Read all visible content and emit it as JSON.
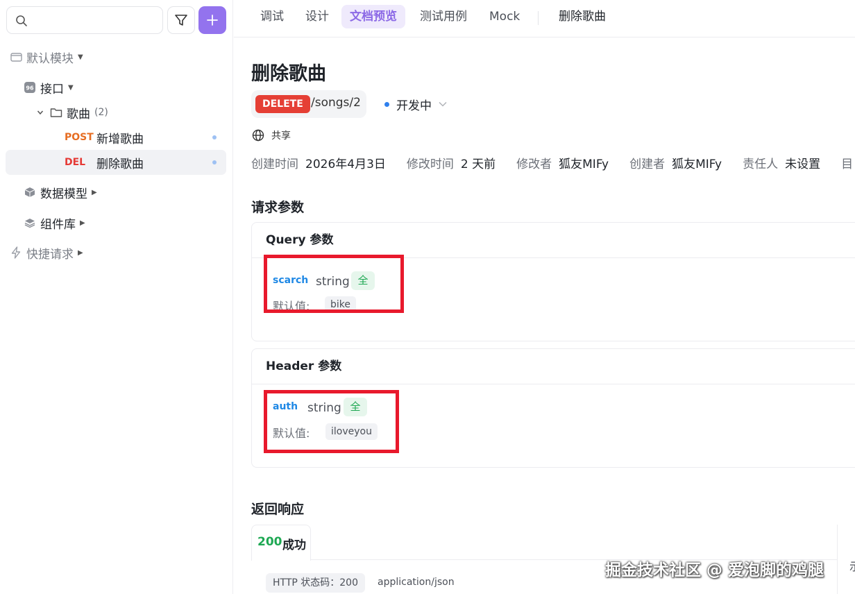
{
  "sidebar": {
    "module": "默认模块",
    "interfaces": "接口",
    "folder": {
      "name": "歌曲",
      "count": "(2)"
    },
    "items": [
      {
        "method": "POST",
        "name": "新增歌曲"
      },
      {
        "method": "DEL",
        "name": "删除歌曲"
      }
    ],
    "data_models": "数据模型",
    "components": "组件库",
    "quick_request": "快捷请求"
  },
  "tabs": [
    "调试",
    "设计",
    "文档预览",
    "测试用例",
    "Mock"
  ],
  "tab_title": "删除歌曲",
  "page": {
    "title": "删除歌曲",
    "method": "DELETE",
    "path": "/songs/2",
    "status": "开发中",
    "share": "共享"
  },
  "meta": [
    {
      "key": "创建时间",
      "value": "2026年4月3日"
    },
    {
      "key": "修改时间",
      "value": "2 天前"
    },
    {
      "key": "修改者",
      "value": "狐友MIFy"
    },
    {
      "key": "创建者",
      "value": "狐友MIFy"
    },
    {
      "key": "责任人",
      "value": "未设置"
    },
    {
      "key": "目",
      "value": ""
    }
  ],
  "request_params_title": "请求参数",
  "query": {
    "header": "Query 参数",
    "name": "scarch",
    "type": "string",
    "required": "全",
    "default_label": "默认值:",
    "default_value": "bike"
  },
  "header_params": {
    "header": "Header 参数",
    "name": "auth",
    "type": "string",
    "required": "全",
    "default_label": "默认值:",
    "default_value": "iloveyou"
  },
  "response": {
    "title": "返回响应",
    "code": "200",
    "status_text": "成功",
    "http_status": "HTTP 状态码：200",
    "content_type": "application/json",
    "right_edge_text": "示"
  },
  "watermark": "掘金技术社区 @ 爱泡脚的鸡腿",
  "colors": {
    "accent": "#9373ee",
    "delete": "#e53f35",
    "post": "#e66d22",
    "success": "#1ea853",
    "param_link": "#1e88e5",
    "highlight": "#e8192c"
  }
}
